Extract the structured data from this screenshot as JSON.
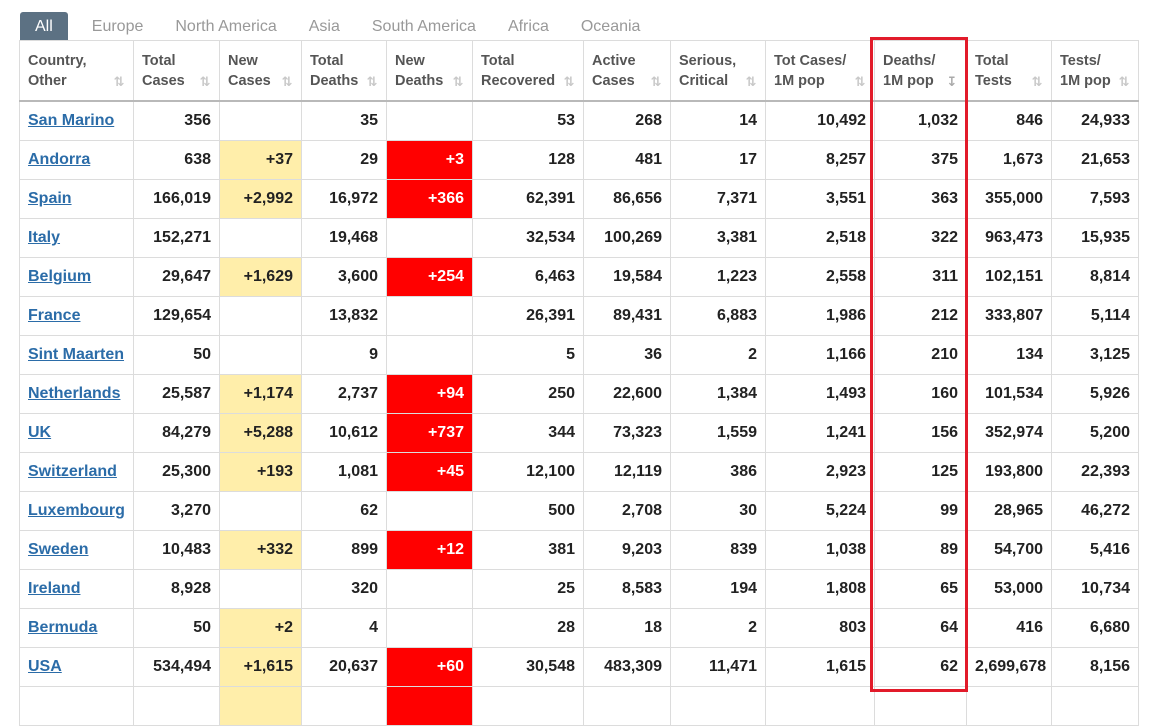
{
  "tabs": [
    "All",
    "Europe",
    "North America",
    "Asia",
    "South America",
    "Africa",
    "Oceania"
  ],
  "active_tab": "All",
  "columns": [
    {
      "line1": "Country,",
      "line2": "Other"
    },
    {
      "line1": "Total",
      "line2": "Cases"
    },
    {
      "line1": "New",
      "line2": "Cases"
    },
    {
      "line1": "Total",
      "line2": "Deaths"
    },
    {
      "line1": "New",
      "line2": "Deaths"
    },
    {
      "line1": "Total",
      "line2": "Recovered"
    },
    {
      "line1": "Active",
      "line2": "Cases"
    },
    {
      "line1": "Serious,",
      "line2": "Critical"
    },
    {
      "line1": "Tot Cases/",
      "line2": "1M pop"
    },
    {
      "line1": "Deaths/",
      "line2": "1M pop"
    },
    {
      "line1": "Total",
      "line2": "Tests"
    },
    {
      "line1": "Tests/",
      "line2": "1M pop"
    }
  ],
  "sort_icons": {
    "inactive": "sort-arrows-icon",
    "active": "sort-descending-icon",
    "sorted_column_index": 9
  },
  "highlighted_column": "Deaths/ 1M pop",
  "colors": {
    "tab_active_bg": "#5c7183",
    "link": "#2b6ca8",
    "new_cases_bg": "#ffeeaa",
    "new_deaths_bg": "#ff0000",
    "highlight_border": "#e21b2a"
  },
  "rows": [
    [
      "San Marino",
      "356",
      "",
      "35",
      "",
      "53",
      "268",
      "14",
      "10,492",
      "1,032",
      "846",
      "24,933"
    ],
    [
      "Andorra",
      "638",
      "+37",
      "29",
      "+3",
      "128",
      "481",
      "17",
      "8,257",
      "375",
      "1,673",
      "21,653"
    ],
    [
      "Spain",
      "166,019",
      "+2,992",
      "16,972",
      "+366",
      "62,391",
      "86,656",
      "7,371",
      "3,551",
      "363",
      "355,000",
      "7,593"
    ],
    [
      "Italy",
      "152,271",
      "",
      "19,468",
      "",
      "32,534",
      "100,269",
      "3,381",
      "2,518",
      "322",
      "963,473",
      "15,935"
    ],
    [
      "Belgium",
      "29,647",
      "+1,629",
      "3,600",
      "+254",
      "6,463",
      "19,584",
      "1,223",
      "2,558",
      "311",
      "102,151",
      "8,814"
    ],
    [
      "France",
      "129,654",
      "",
      "13,832",
      "",
      "26,391",
      "89,431",
      "6,883",
      "1,986",
      "212",
      "333,807",
      "5,114"
    ],
    [
      "Sint Maarten",
      "50",
      "",
      "9",
      "",
      "5",
      "36",
      "2",
      "1,166",
      "210",
      "134",
      "3,125"
    ],
    [
      "Netherlands",
      "25,587",
      "+1,174",
      "2,737",
      "+94",
      "250",
      "22,600",
      "1,384",
      "1,493",
      "160",
      "101,534",
      "5,926"
    ],
    [
      "UK",
      "84,279",
      "+5,288",
      "10,612",
      "+737",
      "344",
      "73,323",
      "1,559",
      "1,241",
      "156",
      "352,974",
      "5,200"
    ],
    [
      "Switzerland",
      "25,300",
      "+193",
      "1,081",
      "+45",
      "12,100",
      "12,119",
      "386",
      "2,923",
      "125",
      "193,800",
      "22,393"
    ],
    [
      "Luxembourg",
      "3,270",
      "",
      "62",
      "",
      "500",
      "2,708",
      "30",
      "5,224",
      "99",
      "28,965",
      "46,272"
    ],
    [
      "Sweden",
      "10,483",
      "+332",
      "899",
      "+12",
      "381",
      "9,203",
      "839",
      "1,038",
      "89",
      "54,700",
      "5,416"
    ],
    [
      "Ireland",
      "8,928",
      "",
      "320",
      "",
      "25",
      "8,583",
      "194",
      "1,808",
      "65",
      "53,000",
      "10,734"
    ],
    [
      "Bermuda",
      "50",
      "+2",
      "4",
      "",
      "28",
      "18",
      "2",
      "803",
      "64",
      "416",
      "6,680"
    ],
    [
      "USA",
      "534,494",
      "+1,615",
      "20,637",
      "+60",
      "30,548",
      "483,309",
      "11,471",
      "1,615",
      "62",
      "2,699,678",
      "8,156"
    ]
  ],
  "partial_next_row": {
    "new_cases_filled": true,
    "new_deaths_filled": true
  }
}
